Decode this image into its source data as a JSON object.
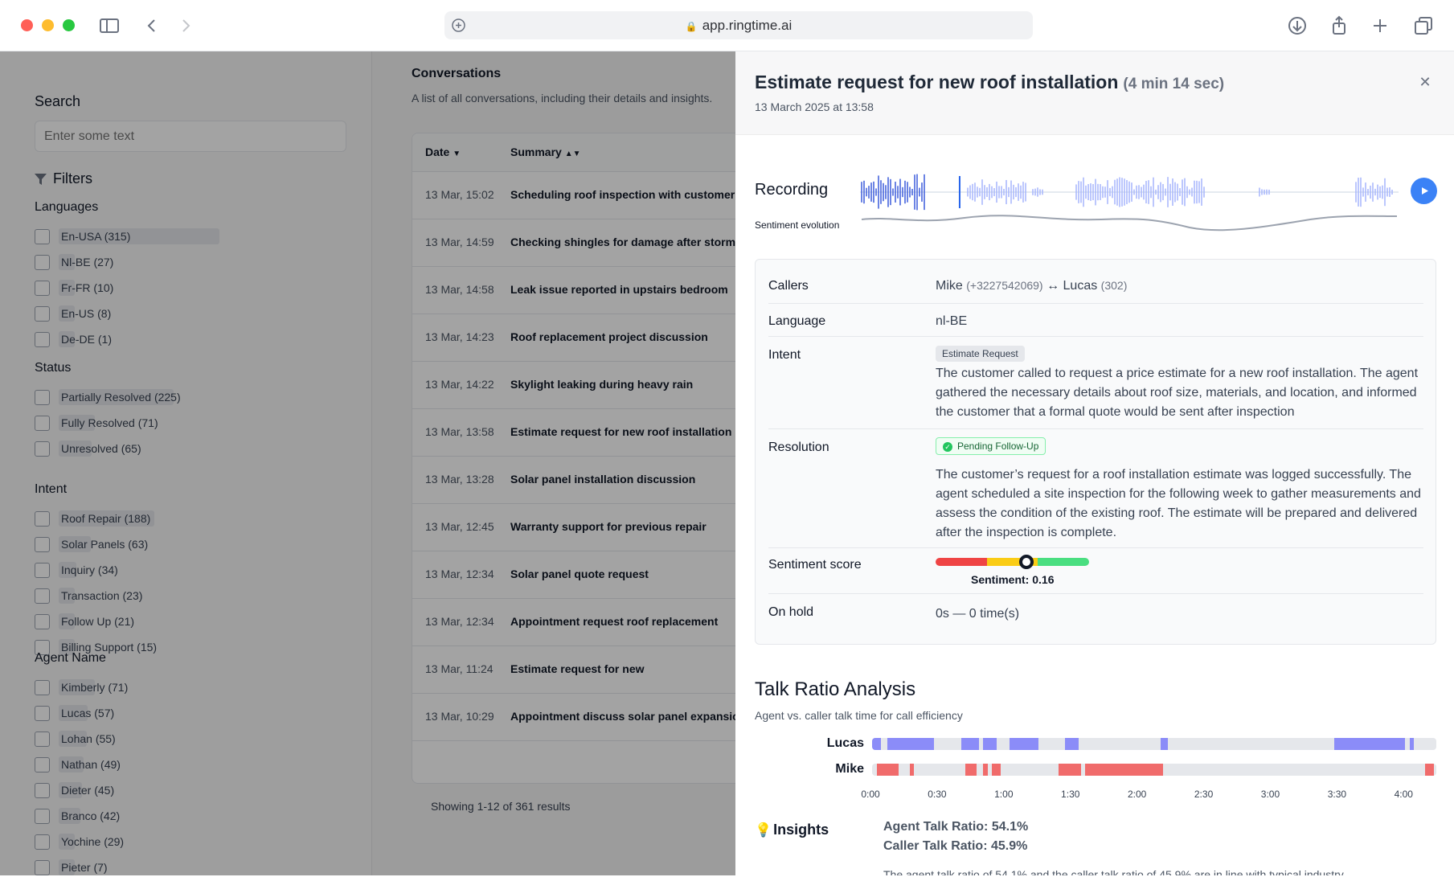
{
  "browser": {
    "url": "app.ringtime.ai"
  },
  "sidebar": {
    "search_label": "Search",
    "search_placeholder": "Enter some text",
    "filters_label": "Filters",
    "sections": [
      {
        "title": "Languages",
        "items": [
          {
            "label": "En-USA (315)",
            "count": 315
          },
          {
            "label": "Nl-BE (27)",
            "count": 27
          },
          {
            "label": "Fr-FR (10)",
            "count": 10
          },
          {
            "label": "En-US (8)",
            "count": 8
          },
          {
            "label": "De-DE (1)",
            "count": 1
          }
        ]
      },
      {
        "title": "Status",
        "items": [
          {
            "label": "Partially Resolved (225)",
            "count": 225
          },
          {
            "label": "Fully Resolved (71)",
            "count": 71
          },
          {
            "label": "Unresolved (65)",
            "count": 65
          }
        ]
      },
      {
        "title": "Intent",
        "items": [
          {
            "label": "Roof Repair (188)",
            "count": 188
          },
          {
            "label": "Solar Panels (63)",
            "count": 63
          },
          {
            "label": "Inquiry (34)",
            "count": 34
          },
          {
            "label": "Transaction (23)",
            "count": 23
          },
          {
            "label": "Follow Up (21)",
            "count": 21
          },
          {
            "label": "Billing Support (15)",
            "count": 15
          }
        ]
      },
      {
        "title": "Agent Name",
        "items": [
          {
            "label": "Kimberly (71)",
            "count": 71
          },
          {
            "label": "Lucas (57)",
            "count": 57
          },
          {
            "label": "Lohan (55)",
            "count": 55
          },
          {
            "label": "Nathan (49)",
            "count": 49
          },
          {
            "label": "Dieter (45)",
            "count": 45
          },
          {
            "label": "Branco (42)",
            "count": 42
          },
          {
            "label": "Yochine (29)",
            "count": 29
          },
          {
            "label": "Pieter (7)",
            "count": 7
          }
        ]
      }
    ]
  },
  "conversations": {
    "title": "Conversations",
    "subtitle": "A list of all conversations, including their details and insights.",
    "col_date": "Date",
    "col_summary": "Summary",
    "rows": [
      {
        "date": "13 Mar, 15:02",
        "summary": "Scheduling roof inspection with customer"
      },
      {
        "date": "13 Mar, 14:59",
        "summary": "Checking shingles for damage after storm"
      },
      {
        "date": "13 Mar, 14:58",
        "summary": "Leak issue reported in upstairs bedroom"
      },
      {
        "date": "13 Mar, 14:23",
        "summary": "Roof replacement project discussion"
      },
      {
        "date": "13 Mar, 14:22",
        "summary": "Skylight leaking during heavy rain"
      },
      {
        "date": "13 Mar, 13:58",
        "summary": "Estimate request for new roof installation"
      },
      {
        "date": "13 Mar, 13:28",
        "summary": "Solar panel installation discussion"
      },
      {
        "date": "13 Mar, 12:45",
        "summary": "Warranty support for previous repair"
      },
      {
        "date": "13 Mar, 12:34",
        "summary": "Solar panel quote request"
      },
      {
        "date": "13 Mar, 12:34",
        "summary": "Appointment request roof replacement"
      },
      {
        "date": "13 Mar, 11:24",
        "summary": "Estimate request for new"
      },
      {
        "date": "13 Mar, 10:29",
        "summary": "Appointment discuss solar panel expansion"
      }
    ],
    "showing": "Showing 1-12 of 361 results"
  },
  "detail": {
    "title": "Estimate request for new roof installation",
    "duration": "(4 min 14 sec)",
    "date": "13 March 2025 at 13:58",
    "close_glyph": "✕",
    "recording_label": "Recording",
    "sentiment_evolution_label": "Sentiment evolution",
    "playhead_fraction": 0.185,
    "callers_label": "Callers",
    "caller_a": "Mike",
    "caller_a_number": "(+3227542069)",
    "caller_arrow": "↔",
    "caller_b": "Lucas",
    "caller_b_number": "(302)",
    "language_label": "Language",
    "language_value": "nl-BE",
    "intent_label": "Intent",
    "intent_tag": "Estimate Request",
    "intent_text": "The customer called to request a price estimate for a new roof installation. The agent gathered the necessary details about roof size, materials, and location, and informed the customer that a formal quote would be sent after inspection",
    "resolution_label": "Resolution",
    "resolution_tag": "Pending Follow-Up",
    "resolution_text": "The customer’s request for a roof installation estimate was logged successfully. The agent scheduled a site inspection for the following week to gather measurements and assess the condition of the existing roof. The estimate will be prepared and delivered after the inspection is complete.",
    "sentiment_label": "Sentiment score",
    "sentiment_value_text": "Sentiment: 0.16",
    "sentiment_value": 0.16,
    "on_hold_label": "On hold",
    "on_hold_value": "0s — 0 time(s)"
  },
  "talk_ratio": {
    "title": "Talk Ratio Analysis",
    "subtitle": "Agent vs. caller talk time for call efficiency",
    "agent_name": "Lucas",
    "caller_name": "Mike",
    "agent_color": "#8b8cf8",
    "caller_color": "#f06b6b",
    "total_seconds": 254,
    "agent_segments": [
      [
        0,
        4
      ],
      [
        7,
        20
      ],
      [
        20,
        28
      ],
      [
        40,
        48
      ],
      [
        50,
        56
      ],
      [
        62,
        75
      ],
      [
        87,
        93
      ],
      [
        130,
        133
      ],
      [
        208,
        240
      ],
      [
        242,
        244
      ]
    ],
    "caller_segments": [
      [
        2,
        12
      ],
      [
        17,
        19
      ],
      [
        42,
        47
      ],
      [
        50,
        52
      ],
      [
        54,
        58
      ],
      [
        84,
        94
      ],
      [
        96,
        131
      ],
      [
        249,
        253
      ]
    ],
    "ticks": [
      "0:00",
      "0:30",
      "1:00",
      "1:30",
      "2:00",
      "2:30",
      "3:00",
      "3:30",
      "4:00"
    ],
    "insights_label": "Insights",
    "agent_ratio": "Agent Talk Ratio: 54.1%",
    "caller_ratio": "Caller Talk Ratio: 45.9%",
    "insight_text": "The agent talk ratio of 54.1% and the caller talk ratio of 45.9% are in line with typical industry"
  },
  "colors": {
    "accent": "#3b82f6",
    "waveform": "#3b5bdb",
    "sentiment_red": "#ef4444",
    "sentiment_yellow": "#facc15",
    "sentiment_green": "#4ade80"
  }
}
